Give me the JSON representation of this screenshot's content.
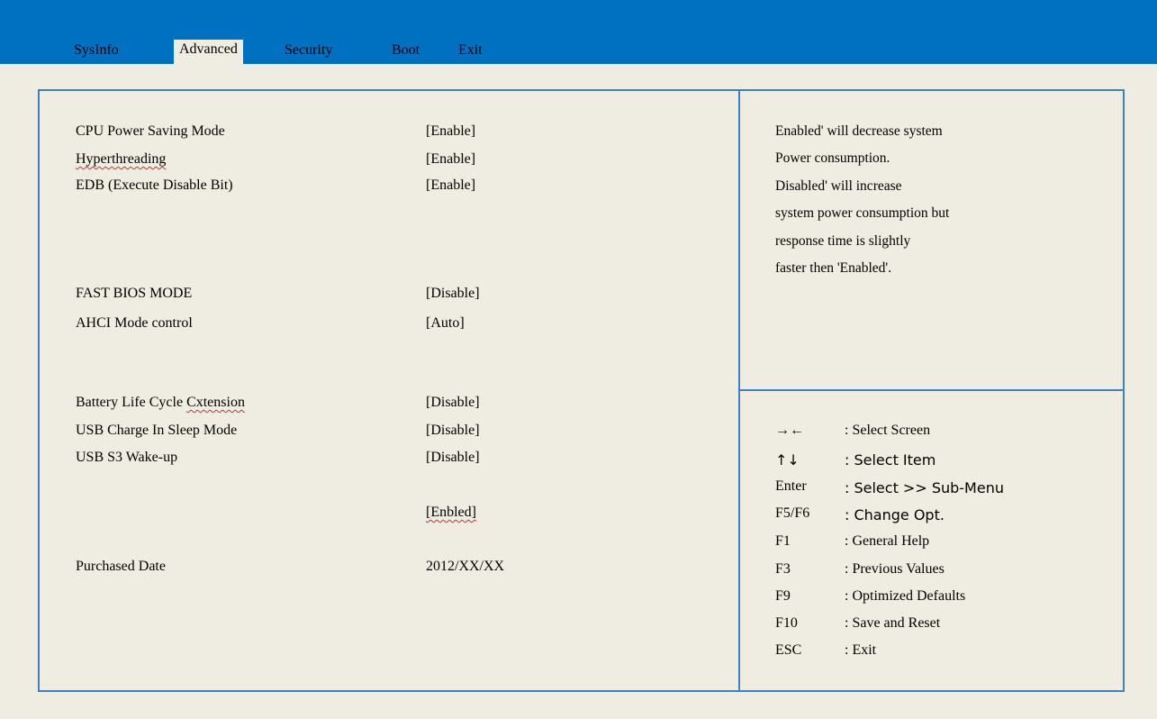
{
  "tabs": [
    "SysInfo",
    "Advanced",
    "Security",
    "Boot",
    "Exit"
  ],
  "settings": [
    {
      "label": "CPU Power Saving Mode",
      "value": "[Enable]"
    },
    {
      "label": "Hyperthreading",
      "value": "[Enable]"
    },
    {
      "label": "EDB (Execute Disable Bit)",
      "value": "[Enable]"
    },
    {
      "label": "FAST BIOS MODE",
      "value": "[Disable]"
    },
    {
      "label": "AHCI Mode control",
      "value": "[Auto]"
    },
    {
      "label": "Battery Life Cycle Cxtension",
      "value": "[Disable]"
    },
    {
      "label": "USB Charge In Sleep Mode",
      "value": "[Disable]"
    },
    {
      "label": "USB S3 Wake-up",
      "value": "[Disable]"
    },
    {
      "label": "",
      "value": "[Enbled]"
    },
    {
      "label": "Purchased Date",
      "value": "2012/XX/XX"
    }
  ],
  "help": [
    "Enabled' will decrease system",
    "Power consumption.",
    "Disabled' will increase",
    "system power consumption but",
    "response time is slightly",
    "faster then 'Enabled'."
  ],
  "keys": [
    {
      "key": "→←",
      "desc": ": Select Screen"
    },
    {
      "key": "↑↓",
      "desc": ": Select Item"
    },
    {
      "key": "Enter",
      "desc": ": Select >> Sub-Menu"
    },
    {
      "key": "F5/F6",
      "desc": ": Change Opt."
    },
    {
      "key": "F1",
      "desc": ": General Help"
    },
    {
      "key": "F3",
      "desc": ": Previous Values"
    },
    {
      "key": "F9",
      "desc": ": Optimized Defaults"
    },
    {
      "key": "F10",
      "desc": ": Save and Reset"
    },
    {
      "key": "ESC",
      "desc": ": Exit"
    }
  ],
  "colors": {
    "titlebar": "#0070c0",
    "background": "#efece1",
    "frame": "#3e81c0"
  }
}
